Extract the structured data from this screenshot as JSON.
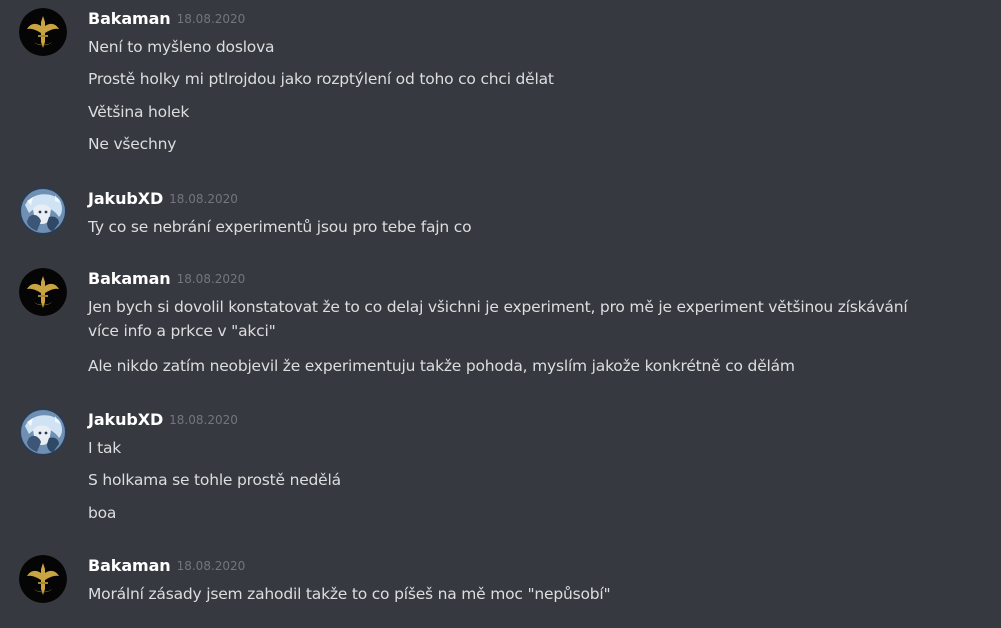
{
  "messages": [
    {
      "author": "Bakaman",
      "avatar_icon": "winged-dagger-emblem-icon",
      "timestamp": "18.08.2020",
      "lines": [
        "Není to myšleno doslova",
        "Prostě holky mi ptlrojdou jako rozptýlení od toho co chci dělat",
        "Většina holek",
        "Ne všechny"
      ]
    },
    {
      "author": "JakubXD",
      "avatar_icon": "anime-character-avatar-icon",
      "timestamp": "18.08.2020",
      "lines": [
        "Ty co se nebrání experimentů jsou pro tebe fajn co"
      ]
    },
    {
      "author": "Bakaman",
      "avatar_icon": "winged-dagger-emblem-icon",
      "timestamp": "18.08.2020",
      "lines": [
        "Jen bych si dovolil konstatovat že to co delaj všichni je experiment, pro mě je experiment většinou získávání více info a prkce v \"akci\"",
        "Ale nikdo zatím neobjevil že experimentuju takže pohoda, myslím jakože konkrétně co dělám"
      ]
    },
    {
      "author": "JakubXD",
      "avatar_icon": "anime-character-avatar-icon",
      "timestamp": "18.08.2020",
      "lines": [
        "I tak",
        "S holkama se tohle prostě nedělá",
        "boa"
      ]
    },
    {
      "author": "Bakaman",
      "avatar_icon": "winged-dagger-emblem-icon",
      "timestamp": "18.08.2020",
      "lines": [
        "Morální zásady jsem zahodil takže to co píšeš na mě moc \"nepůsobí\""
      ]
    }
  ],
  "colors": {
    "background": "#36393f",
    "username": "#ffffff",
    "timestamp": "#72767d",
    "message_text": "#dcddde",
    "emblem_gold": "#c9a443"
  }
}
